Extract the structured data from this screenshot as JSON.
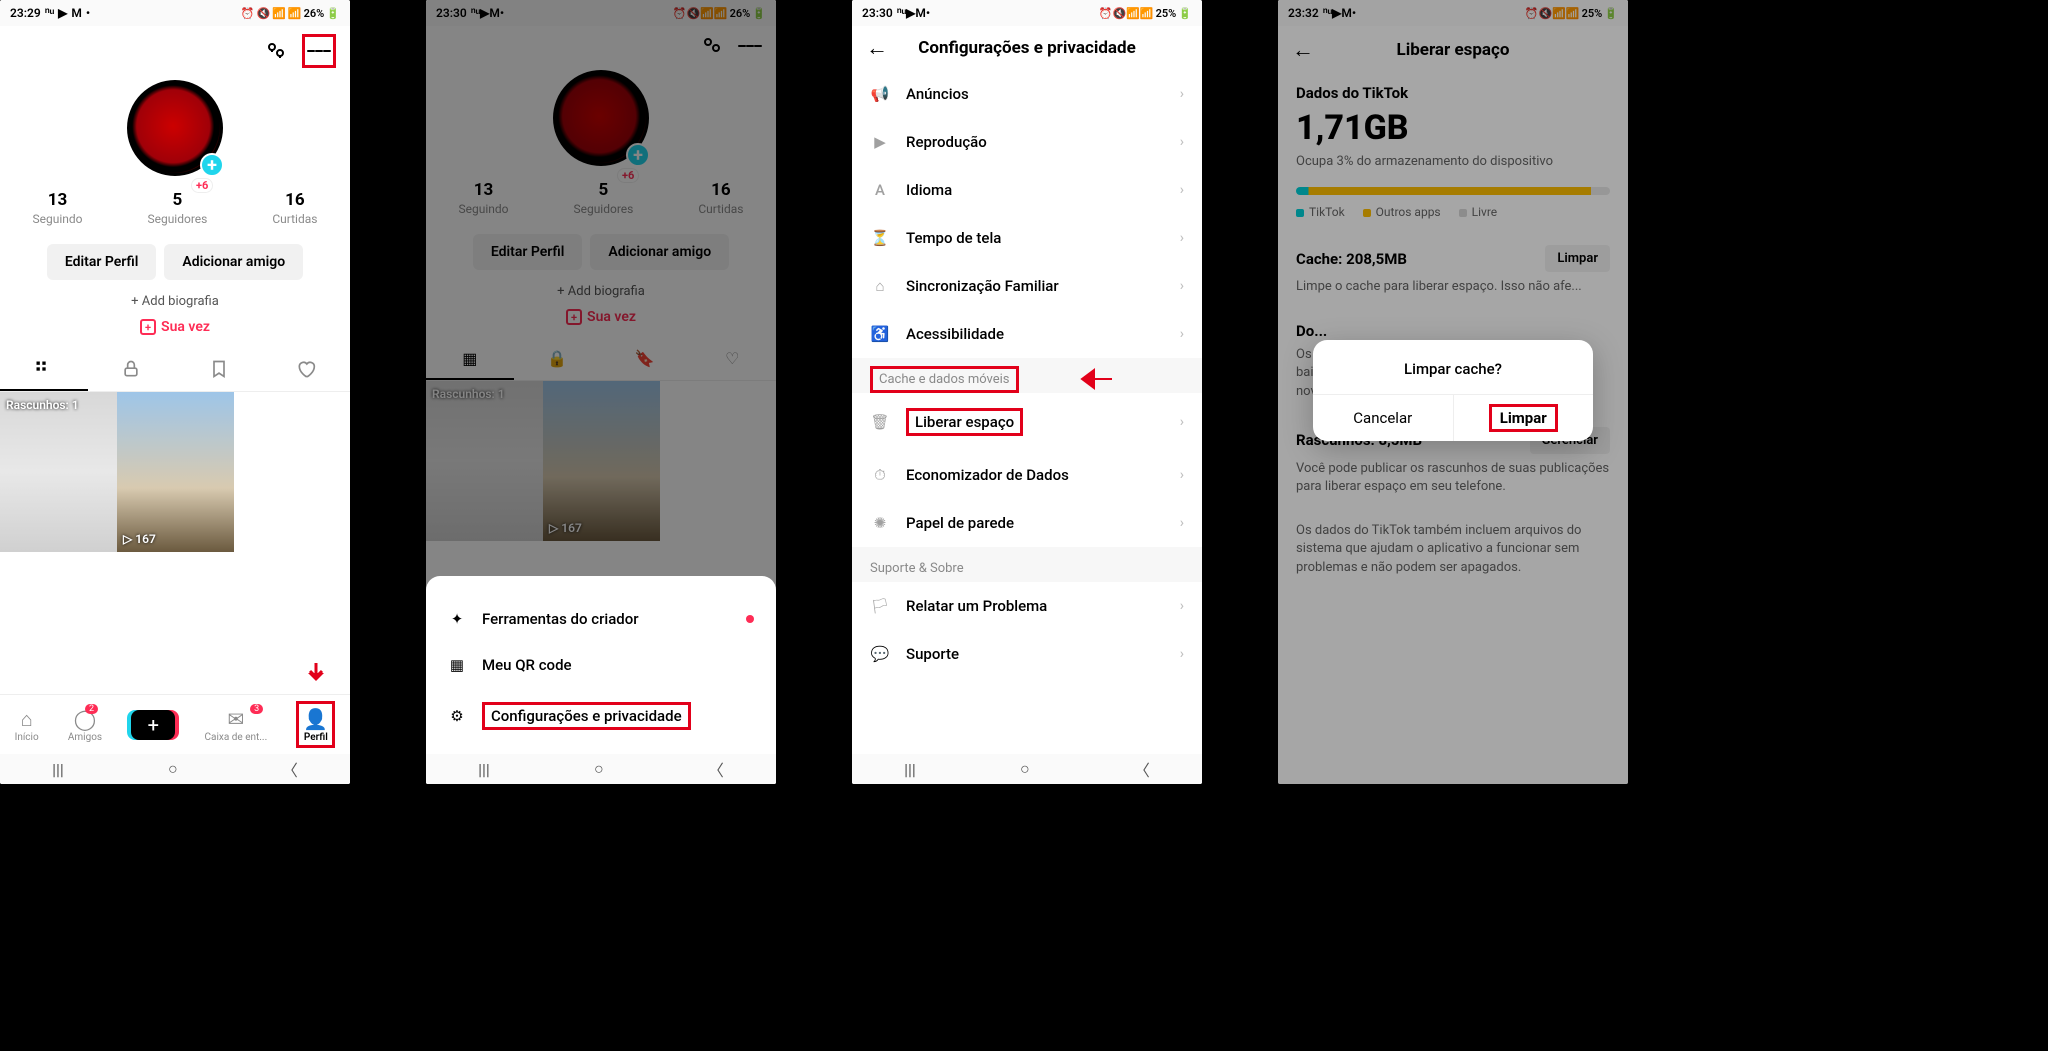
{
  "screens": [
    {
      "statusbar": {
        "time": "23:29",
        "battery": "26%"
      }
    },
    {
      "statusbar": {
        "time": "23:30",
        "battery": "26%"
      }
    },
    {
      "statusbar": {
        "time": "23:30",
        "battery": "25%"
      }
    },
    {
      "statusbar": {
        "time": "23:32",
        "battery": "25%"
      }
    }
  ],
  "profile": {
    "stats": {
      "following": {
        "num": "13",
        "label": "Seguindo"
      },
      "followers": {
        "num": "5",
        "label": "Seguidores",
        "badge": "+6"
      },
      "likes": {
        "num": "16",
        "label": "Curtidas"
      }
    },
    "edit_button": "Editar Perfil",
    "add_friend_button": "Adicionar amigo",
    "add_bio": "+ Add biografia",
    "sua_vez": "Sua vez",
    "drafts_label": "Rascunhos: 1",
    "views": "167"
  },
  "bottomnav": {
    "home": "Início",
    "friends": "Amigos",
    "friends_badge": "2",
    "inbox": "Caixa de ent...",
    "inbox_badge": "3",
    "profile": "Perfil"
  },
  "drawer": {
    "creator": "Ferramentas do criador",
    "qr": "Meu QR code",
    "settings": "Configurações e privacidade"
  },
  "settings": {
    "title": "Configurações e privacidade",
    "rows": {
      "anuncios": "Anúncios",
      "reproducao": "Reprodução",
      "idioma": "Idioma",
      "tempo": "Tempo de tela",
      "familia": "Sincronização Familiar",
      "acess": "Acessibilidade",
      "section_cache": "Cache e dados móveis",
      "liberar": "Liberar espaço",
      "econom": "Economizador de Dados",
      "papel": "Papel de parede",
      "section_suporte": "Suporte & Sobre",
      "problema": "Relatar um Problema",
      "suporte": "Suporte"
    }
  },
  "freespace": {
    "title": "Liberar espaço",
    "data_title": "Dados do TikTok",
    "size": "1,71GB",
    "pct": "Ocupa 3% do armazenamento do dispositivo",
    "legend": {
      "tt": "TikTok",
      "oa": "Outros apps",
      "fr": "Livre"
    },
    "cache": {
      "label": "Cache: 208,5MB",
      "action": "Limpar",
      "desc": "Limpe o cache para liberar espaço. Isso não afe..."
    },
    "downloads": {
      "label": "Do...",
      "desc": "Os stickers, vídeos offline e presentes virtuais baixados no seu app. Você poderá baixá-los novamente se precisar."
    },
    "rascunhos": {
      "label": "Rascunhos: 8,5MB",
      "action": "Gerenciar",
      "desc": "Você pode publicar os rascunhos de suas publicações para liberar espaço em seu telefone."
    },
    "note": "Os dados do TikTok também incluem arquivos do sistema que ajudam o aplicativo a funcionar sem problemas e não podem ser apagados."
  },
  "modal": {
    "title": "Limpar cache?",
    "cancel": "Cancelar",
    "confirm": "Limpar"
  }
}
